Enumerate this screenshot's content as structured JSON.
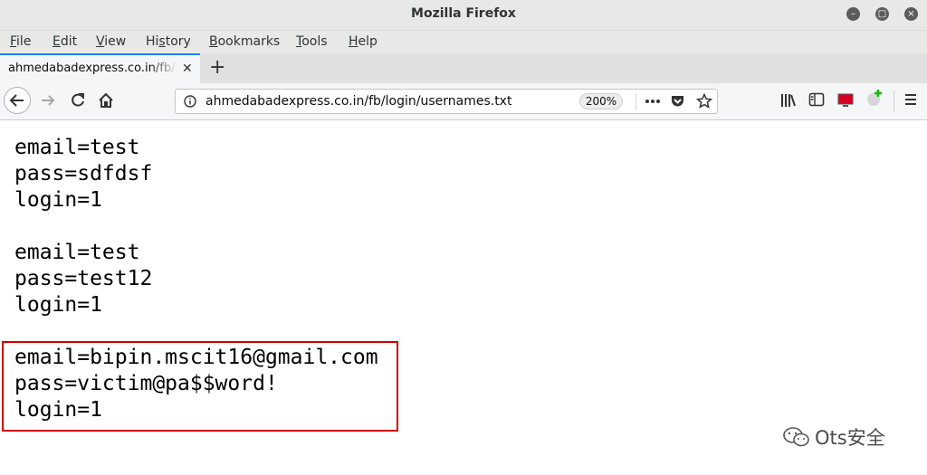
{
  "window": {
    "title": "Mozilla Firefox"
  },
  "menu": {
    "items": [
      {
        "label": "File",
        "key": "F",
        "rest": "ile"
      },
      {
        "label": "Edit",
        "key": "E",
        "rest": "dit"
      },
      {
        "label": "View",
        "key": "V",
        "rest": "iew"
      },
      {
        "label": "History",
        "pre": "Hi",
        "key": "s",
        "rest": "tory"
      },
      {
        "label": "Bookmarks",
        "key": "B",
        "rest": "ookmarks"
      },
      {
        "label": "Tools",
        "key": "T",
        "rest": "ools"
      },
      {
        "label": "Help",
        "key": "H",
        "rest": "elp"
      }
    ]
  },
  "tab": {
    "title": "ahmedabadexpress.co.in/fb/login/usernames.txt"
  },
  "urlbar": {
    "url": "ahmedabadexpress.co.in/fb/login/usernames.txt",
    "zoom": "200%"
  },
  "content": {
    "lines": [
      "email=test",
      "pass=sdfdsf",
      "login=1",
      "",
      "email=test",
      "pass=test12",
      "login=1",
      "",
      "email=bipin.mscit16@gmail.com",
      "pass=victim@pa$$word!",
      "login=1"
    ]
  },
  "watermark": {
    "text": "Ots安全"
  },
  "colors": {
    "highlight": "#d40000",
    "tab_accent": "#0a84ff"
  }
}
